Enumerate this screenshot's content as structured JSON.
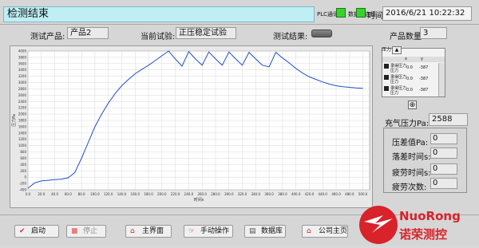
{
  "header": {
    "status_text": "检测结束",
    "plc_label": "PLC通讯",
    "db_label": "数据库连接",
    "time_label": "时间",
    "datetime": "2016/6/21 10:22:32"
  },
  "info": {
    "product_label": "测试产品:",
    "product_value": "产品2",
    "test_label": "当前试验:",
    "test_value": "正压稳定试验",
    "result_label": "测试结果:",
    "quantity_label": "产品数量",
    "quantity_value": "3"
  },
  "legend": {
    "tab_label": "压力",
    "head_col1": "x",
    "head_col2": "y",
    "rows": [
      {
        "name": "录得压力",
        "unit": "压力",
        "x": "0.0",
        "y": "-387"
      },
      {
        "name": "录得压力",
        "unit": "压力",
        "x": "0.0",
        "y": "-387"
      },
      {
        "name": "录得压力",
        "unit": "压力",
        "x": "0.0",
        "y": "-387"
      }
    ]
  },
  "readouts": {
    "fill_label": "充气压力Pa:",
    "fill_value": "2588",
    "stats": [
      {
        "label": "压差值Pa:",
        "value": "0"
      },
      {
        "label": "落差时间s:",
        "value": "0"
      },
      {
        "label": "疲劳时间s:",
        "value": "0"
      },
      {
        "label": "疲劳次数:",
        "value": "0"
      }
    ]
  },
  "buttons": [
    {
      "label": "启动",
      "icon": "check-icon"
    },
    {
      "label": "停止",
      "icon": "stop-icon"
    },
    {
      "label": "主界面",
      "icon": "home-icon"
    },
    {
      "label": "手动操作",
      "icon": "hand-icon"
    },
    {
      "label": "数据库",
      "icon": "database-icon"
    },
    {
      "label": "公司主页",
      "icon": "home-icon"
    }
  ],
  "logo": {
    "brand": "NuoRong",
    "chinese": "诺荣测控"
  },
  "colors": {
    "title_bg": "#bfeef5",
    "led_on": "#3bd12d",
    "plot_line": "#1f4fcc",
    "logo_red": "#d8232a"
  },
  "chart_data": {
    "type": "line",
    "xlabel": "时间s",
    "ylabel": "压力Pa",
    "xlim": [
      0,
      510
    ],
    "ylim": [
      -400,
      4000
    ],
    "x_ticks": [
      0,
      20,
      40,
      60,
      80,
      100,
      120,
      140,
      160,
      180,
      200,
      220,
      240,
      260,
      280,
      300,
      320,
      340,
      360,
      380,
      400,
      420,
      440,
      460,
      480,
      500
    ],
    "x_tick_labels": [
      "0.0",
      "20.0",
      "40.0",
      "60.0",
      "80.0",
      "100.0",
      "120.0",
      "140.0",
      "160.0",
      "180.0",
      "200.0",
      "220.0",
      "240.0",
      "260.0",
      "280.0",
      "300.0",
      "320.0",
      "340.0",
      "360.0",
      "380.0",
      "400.0",
      "420.0",
      "440.0",
      "460.0",
      "480.0",
      "500.0"
    ],
    "y_ticks": [
      -400,
      -200,
      0,
      200,
      400,
      600,
      800,
      1000,
      1200,
      1400,
      1600,
      1800,
      2000,
      2200,
      2400,
      2600,
      2800,
      3000,
      3200,
      3400,
      3600,
      3800,
      4000
    ],
    "grid": true,
    "series": [
      {
        "color": "#1f4fcc",
        "x": [
          0,
          10,
          20,
          30,
          40,
          50,
          60,
          70,
          80,
          90,
          100,
          110,
          120,
          130,
          140,
          150,
          160,
          170,
          180,
          190,
          200,
          210,
          220,
          230,
          240,
          250,
          260,
          270,
          280,
          290,
          300,
          310,
          320,
          330,
          340,
          350,
          360,
          370,
          380,
          390,
          400,
          410,
          420,
          430,
          440,
          450,
          460,
          470,
          480,
          490,
          500
        ],
        "y": [
          -350,
          -180,
          -120,
          -100,
          -80,
          -60,
          -20,
          150,
          600,
          1100,
          1600,
          2000,
          2350,
          2650,
          2900,
          3100,
          3280,
          3420,
          3550,
          3700,
          3850,
          4000,
          3750,
          3520,
          3980,
          3750,
          3550,
          3970,
          3750,
          3550,
          3970,
          3750,
          3550,
          3960,
          3750,
          3550,
          3500,
          3960,
          3780,
          3620,
          3450,
          3300,
          3180,
          3100,
          3020,
          2950,
          2900,
          2870,
          2850,
          2830,
          2820
        ]
      }
    ]
  }
}
